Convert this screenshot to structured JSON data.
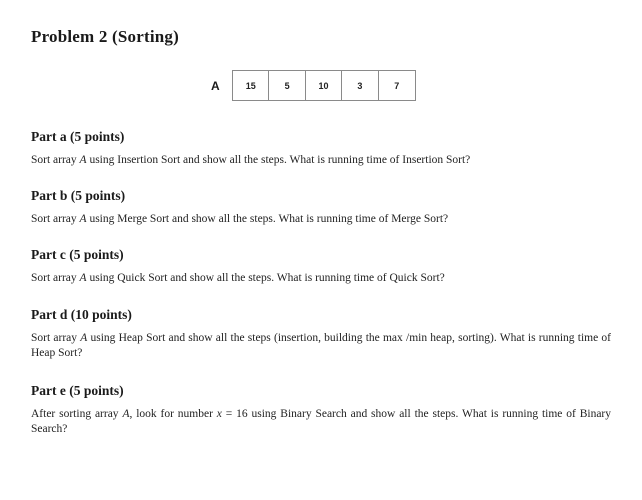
{
  "title": "Problem 2 (Sorting)",
  "array": {
    "label": "A",
    "values": [
      "15",
      "5",
      "10",
      "3",
      "7"
    ]
  },
  "parts": [
    {
      "heading": "Part a (5 points)",
      "pre": "Sort array ",
      "var": "A",
      "post": " using Insertion Sort and show all the steps. What is running time of Insertion Sort?"
    },
    {
      "heading": "Part b (5 points)",
      "pre": "Sort array ",
      "var": "A",
      "post": " using Merge Sort and show all the steps. What is running time of Merge Sort?"
    },
    {
      "heading": "Part c (5 points)",
      "pre": "Sort array ",
      "var": "A",
      "post": " using Quick Sort and show all the steps. What is running time of Quick Sort?"
    },
    {
      "heading": "Part d (10 points)",
      "pre": "Sort array ",
      "var": "A",
      "post": " using Heap Sort and show all the steps (insertion, building the max /min heap, sorting). What is running time of Heap Sort?"
    },
    {
      "heading": "Part e (5 points)",
      "pre": "After sorting array ",
      "var": "A",
      "mid": ", look for number ",
      "var2": "x",
      "post": " = 16 using Binary Search and show all the steps.  What is running time of Binary Search?"
    }
  ]
}
